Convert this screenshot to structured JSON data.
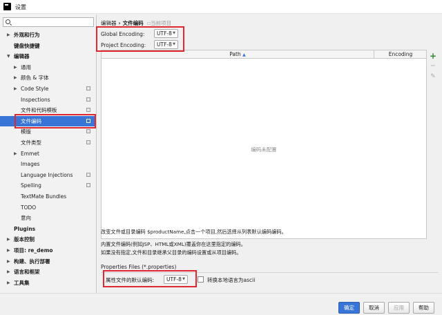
{
  "window": {
    "title": "设置"
  },
  "sidebar": {
    "search": {
      "value": "",
      "placeholder": ""
    },
    "items": [
      {
        "label": "外观和行为",
        "arrow": "▶",
        "bold": true
      },
      {
        "label": "键盘快捷键",
        "arrow": "",
        "bold": true
      },
      {
        "label": "编辑器",
        "arrow": "▼",
        "bold": true
      },
      {
        "label": "通用",
        "arrow": "▶",
        "bold": false
      },
      {
        "label": "颜色 & 字体",
        "arrow": "▶",
        "bold": false
      },
      {
        "label": "Code Style",
        "arrow": "▶",
        "bold": false
      },
      {
        "label": "Inspections",
        "arrow": "",
        "bold": false
      },
      {
        "label": "文件和代码模板",
        "arrow": "",
        "bold": false
      },
      {
        "label": "文件编码",
        "arrow": "",
        "bold": false,
        "selected": true
      },
      {
        "label": "模版",
        "arrow": "",
        "bold": false
      },
      {
        "label": "文件类型",
        "arrow": "",
        "bold": false
      },
      {
        "label": "Emmet",
        "arrow": "▶",
        "bold": false
      },
      {
        "label": "Images",
        "arrow": "",
        "bold": false
      },
      {
        "label": "Language Injections",
        "arrow": "",
        "bold": false
      },
      {
        "label": "Spelling",
        "arrow": "",
        "bold": false
      },
      {
        "label": "TextMate Bundles",
        "arrow": "",
        "bold": false
      },
      {
        "label": "TODO",
        "arrow": "",
        "bold": false
      },
      {
        "label": "意向",
        "arrow": "",
        "bold": false
      },
      {
        "label": "Plugins",
        "arrow": "",
        "bold": true
      },
      {
        "label": "版本控制",
        "arrow": "▶",
        "bold": true
      },
      {
        "label": "项目: re_demo",
        "arrow": "▶",
        "bold": true
      },
      {
        "label": "构建、执行部署",
        "arrow": "▶",
        "bold": true
      },
      {
        "label": "语言和框架",
        "arrow": "▶",
        "bold": true
      },
      {
        "label": "工具集",
        "arrow": "▶",
        "bold": true
      }
    ]
  },
  "breadcrumb": {
    "parent": "编辑器",
    "separator": "›",
    "current": "文件编码",
    "hint": "当前项目"
  },
  "encoding": {
    "global_label": "Global Encoding:",
    "global_value": "UTF-8",
    "project_label": "Project Encoding:",
    "project_value": "UTF-8"
  },
  "table": {
    "columns": [
      "Path",
      "Encoding"
    ],
    "sort_indicator": "▲",
    "empty_text": "编码未配置"
  },
  "tools": {
    "add": "+",
    "remove": "−",
    "edit": "✎"
  },
  "descriptions": {
    "line1": "改变文件或目录编码 $productName,点击一个项目,然后选择从列表默认编码编码。",
    "line2": "内置文件编码(例如JSP、HTML或XML)覆盖你在这里指定的编码。",
    "line3": "如果没有指定,文件和目录继承父目录的编码设置或从项目编码。"
  },
  "properties": {
    "section_title": "Properties Files (*.properties)",
    "default_label": "属性文件的默认编码:",
    "default_value": "UTF-8",
    "ascii_label": "转换本地语言为ascii",
    "ascii_checked": false
  },
  "buttons": {
    "ok": "确定",
    "cancel": "取消",
    "apply": "应用",
    "help": "帮助"
  },
  "colors": {
    "accent": "#3875d7",
    "highlight": "#e0262f"
  }
}
